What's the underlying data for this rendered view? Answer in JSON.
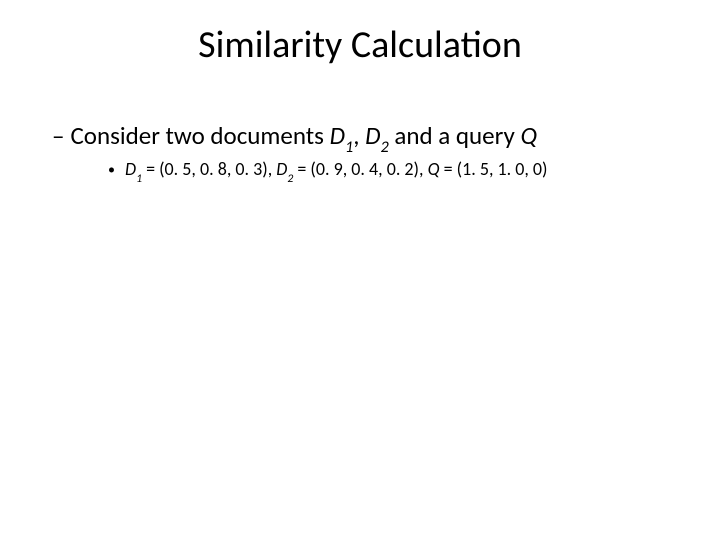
{
  "title": "Similarity Calculation",
  "line1": {
    "dash": "–",
    "t1": "Consider two documents ",
    "D": "D",
    "s1": "1",
    "comma": ", ",
    "s2": "2",
    "t2": " and a query ",
    "Q": "Q"
  },
  "line2": {
    "bullet": "•",
    "D": "D",
    "s1": "1",
    "eq1": " = (0. 5, 0. 8, 0. 3), ",
    "s2": "2",
    "eq2": " = (0. 9, 0. 4, 0. 2), ",
    "Q": "Q",
    "eq3": " = (1. 5, 1. 0, 0)"
  }
}
